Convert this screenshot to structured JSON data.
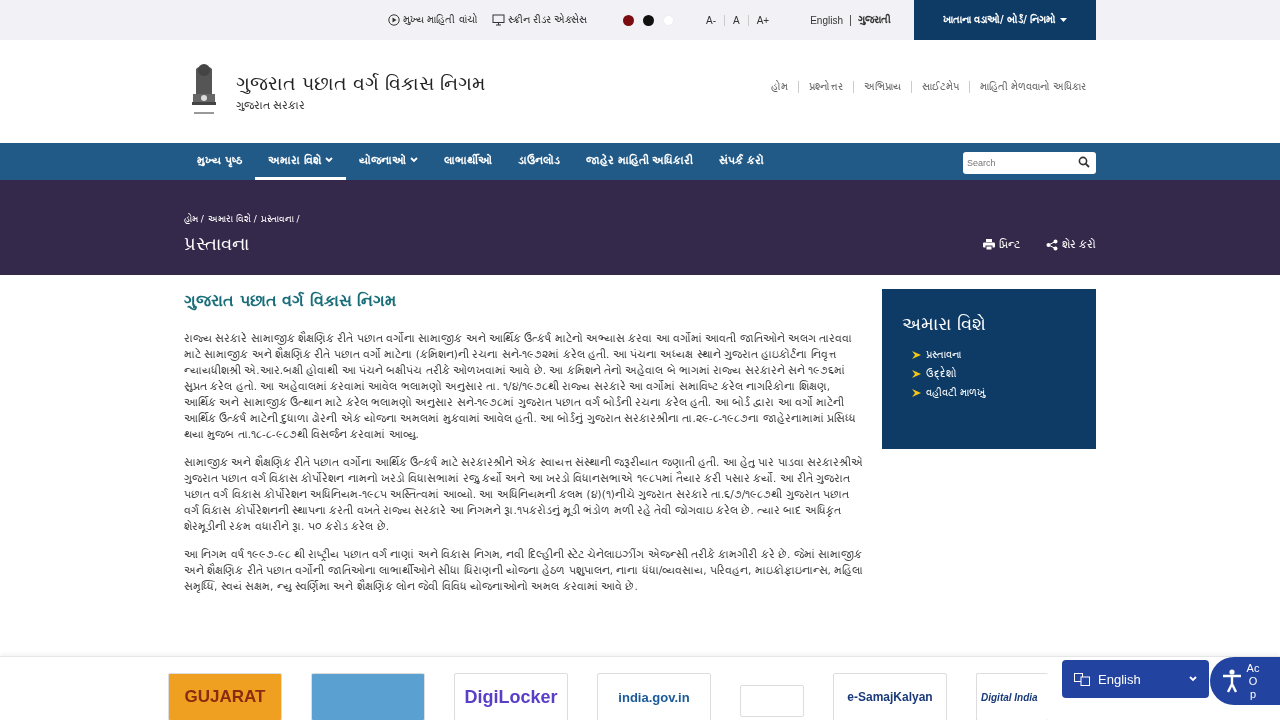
{
  "top_bar": {
    "links": [
      {
        "kind": "audio",
        "label": "મુખ્ય માહિતી વાંચો"
      },
      {
        "kind": "screen",
        "label": "સ્ક્રીન રીડર એક્સેસ"
      }
    ],
    "themes": [
      {
        "color": "#7a0c12"
      },
      {
        "color": "#111111"
      },
      {
        "color": "#ffffff"
      }
    ],
    "font_sizes": [
      "A-",
      "A",
      "A+"
    ],
    "languages": [
      {
        "label": "English",
        "selected": false
      },
      {
        "label": "ગુજરાતી",
        "selected": true
      }
    ],
    "departments_button": "ખાતાના વડાઓ/ બોર્ડ/ નિગમો"
  },
  "header": {
    "title": "ગુજરાત પછાત વર્ગ વિકાસ નિગમ",
    "subtitle": "ગુજરાત સરકાર",
    "links": [
      "હોમ",
      "પ્રશ્નોત્તર",
      "અભિપ્રાય",
      "સાઈટમેપ",
      "માહિતી મેળવવાનો અધિકાર"
    ]
  },
  "nav": {
    "items": [
      {
        "label": "મુખ્ય પૃષ્ઠ",
        "selected": false,
        "dropdown": false
      },
      {
        "label": "અમારા વિશે",
        "selected": true,
        "dropdown": true
      },
      {
        "label": "યોજનાઓ",
        "selected": false,
        "dropdown": true
      },
      {
        "label": "લાભાર્થીઓ",
        "selected": false,
        "dropdown": false
      },
      {
        "label": "ડાઉનલોડ",
        "selected": false,
        "dropdown": false
      },
      {
        "label": "જાહેર માહિતી અધિકારી",
        "selected": false,
        "dropdown": false
      },
      {
        "label": "સંપર્ક કરો",
        "selected": false,
        "dropdown": false
      }
    ],
    "search": {
      "placeholder": "Search"
    }
  },
  "banner": {
    "breadcrumb": [
      "હોમ /",
      "અમારા વિશે /",
      "પ્રસ્તાવના /"
    ],
    "title": "પ્રસ્તાવના",
    "actions": [
      {
        "kind": "print",
        "label": "પ્રિન્ટ"
      },
      {
        "kind": "share",
        "label": "શેર કરો"
      }
    ]
  },
  "article": {
    "heading": "ગુજરાત પછાત વર્ગ વિકાસ નિગમ",
    "paragraphs": [
      "રાજ્ય સરકારે સામાજીક શૈક્ષણિક રીતે પછાત વર્ગોના સામાજીક અને આર્થિક ઉત્કર્ષ માટેનો અભ્યાસ કરવા આ વર્ગોમાં આવતી જાતિઓને અલગ તારવવા માટે સામાજીક અને શૈક્ષણિક રીતે પછાત વર્ગો માટેના (કમિશન)ની રચના સને-૧૯૭૨માં કરેલ હતી. આ પંચના અધ્યક્ષ સ્થાને ગુજરાત હાઇકોર્ટના નિવૃત્ત ન્યાયધીશશ્રી એ.આર.બક્ષી હોવાથી આ પંચને બક્ષીપંચ તરીકે ઓળખવામાં આવે છે. આ કમિશને તેનો અહેવાલ બે ભાગમાં રાજ્ય સરકારને સને ૧૯૭૬માં સુપ્રત કરેલ હતો. આ અહેવાલમાં કરવામાં આવેલ ભલામણો અનુસાર તા. ૧/૪/૧૯૭૮થી રાજ્ય સરકારે આ વર્ગોમાં સમાવિષ્ટ કરેલ નાગરિકોના શિક્ષણ, આર્થિક અને સામાજીક ઉત્થાન માટે કરેલ ભલામણો અનુસાર સને-૧૯૭૮માં ગુજરાત પછાત વર્ગ બોર્ડની રચના કરેલ હતી. આ બોર્ડ દ્વારા આ વર્ગો માટેની આર્થિક ઉત્કર્ષ માટેની દુધાળા ઢોરની એક યોજના અમલમાં મુકવામાં આવેલ હતી. આ બોર્ડનું ગુજરાત સરકારશ્રીના તા.૨૯-૮-૧૯૮૭ના જાહેરનામામાં પ્રસિધ્ધ થયા મુજબ તા.૧૮-૮-૯૮૭થી વિસર્જન કરવામાં આવ્યુ.",
      "સામાજીક અને શૈક્ષણિક રીતે પછાત વર્ગોના આર્થિક ઉત્કર્ષ માટે સરકારશ્રીને એક સ્વાયત્ત સંસ્થાની જરૂરીયાત જણાતી હતી. આ હેતુ પાર પાડવા સરકારશ્રીએ ગુજરાત પછાત વર્ગ વિકાસ કોર્પોરેશન નામનો ખરડો વિધાસભામાં રજુ કર્યો અને આ ખરડો વિધાનસભાએ ૧૯૮૫માં તૈયાર કરી પસાર કર્યો. આ રીતે ગુજરાત પછાત વર્ગ વિકાસ કોર્પોરેશન અધિનિયમ-૧૯૮૫ અસ્તિત્વમાં આવ્યો. આ અધિનિયમની કલમ (૪)(૧)નીચે ગુજરાત સરકારે તા.૬/૭/૧૯૮૭થી ગુજરાત પછાત વર્ગ વિકાસ કોર્પોરેશનની સ્થાપના કરતી વખતે રાજ્ય સરકારે આ નિગમને રૂા.૧૫કરોડનું મૂડી ભંડોળ મળી રહે તેવી જોગવાઇ કરેલ છે. ત્યાર બાદ અધિકૃત શેરમૂડીની રકમ વધારીને રૂા. ૫૦ કરોડ કરેલ છે.",
      "આ નિગમ વર્ષ ૧૯૯૭-૯૮ થી રાષ્ટ્રીય પછાત વર્ગ નાણાં અને વિકાસ નિગમ, નવી દિલ્હીની સ્ટેટ ચેનેલાઇઝીંગ એજન્સી તરીકે કામગીરી કરે છે. જેમાં સામાજીક અને શૈક્ષણિક રીતે પછાત વર્ગોની જાતિઓના લાભાર્થીઓને સીધા ધિરાણની યોજના હેઠળ પશુપાલન, નાના ધંધા/વ્યવસાય, પરિવહન, માઇક્રોફાઇનાન્સ, મહિલા સમૃધ્ધિ, સ્વયં સક્ષમ, ન્યુ સ્વર્ણિમા અને શૈક્ષણિક લોન જેવી વિવિધ યોજનાઓનો અમલ કરવામાં આવે છે."
    ]
  },
  "sidebar": {
    "title": "અમારા વિશે",
    "items": [
      "પ્રસ્તાવના",
      "ઉદ્દેશો",
      "વહીવટી માળખું"
    ]
  },
  "footer_logos": [
    {
      "kind": "gujarat",
      "label": "GUJARAT"
    },
    {
      "kind": "voter"
    },
    {
      "kind": "digilocker",
      "label": "DigiLocker"
    },
    {
      "kind": "indiagov",
      "label": "india.gov.in"
    },
    {
      "kind": "small"
    },
    {
      "kind": "samaj",
      "label": "e-SamajKalyan"
    },
    {
      "kind": "digitalindia",
      "label": "Digital India"
    }
  ],
  "language_widget": {
    "value": "English"
  },
  "accessibility_widget": {
    "label": "Ac Op"
  }
}
